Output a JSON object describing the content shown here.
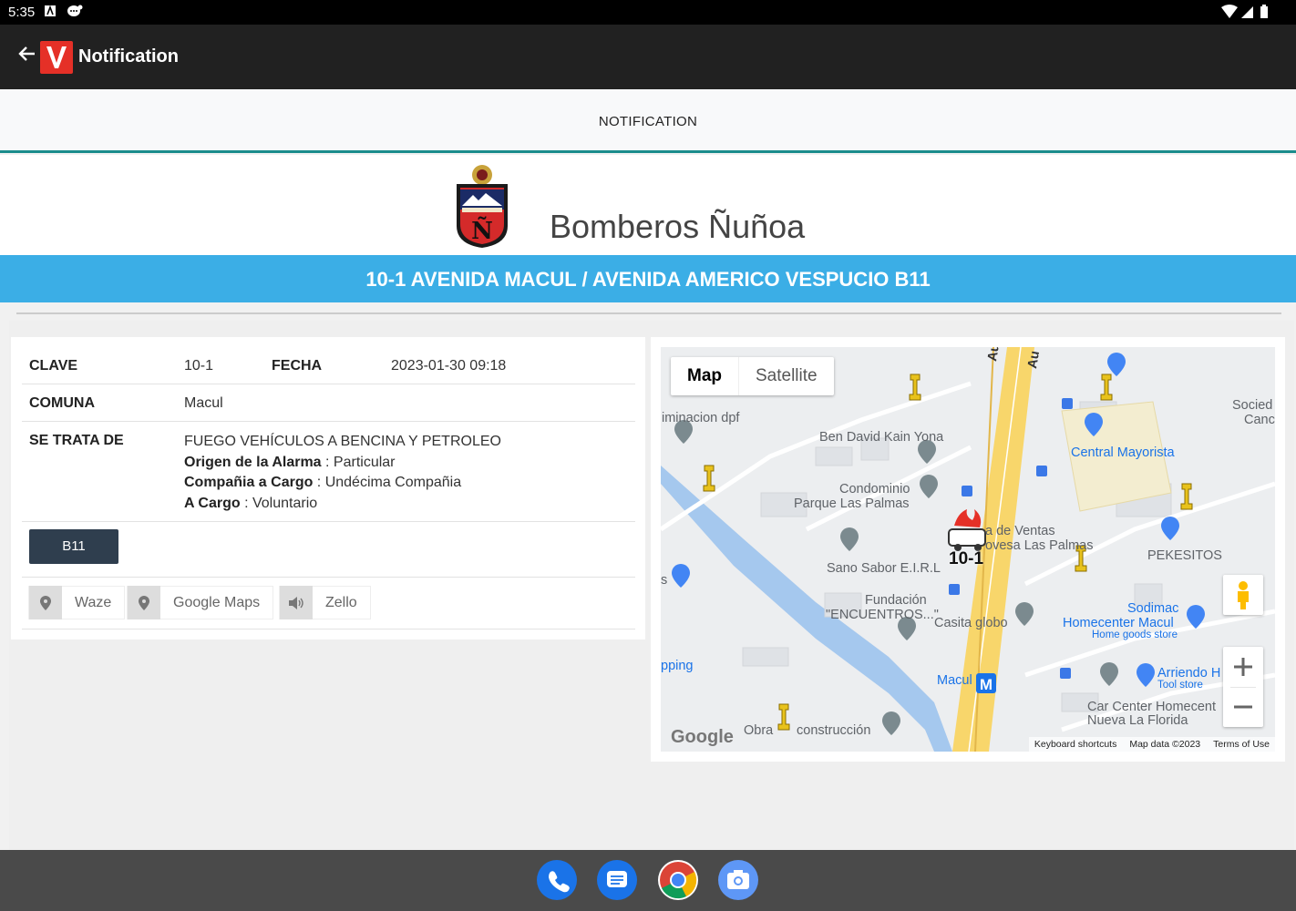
{
  "status": {
    "time": "5:35"
  },
  "appbar": {
    "title": "Notification"
  },
  "tab": {
    "label": "NOTIFICATION"
  },
  "org": {
    "name": "Bomberos Ñuñoa"
  },
  "banner": {
    "text": "10-1 AVENIDA MACUL / AVENIDA AMERICO VESPUCIO B11"
  },
  "details": {
    "clave_label": "CLAVE",
    "clave_value": "10-1",
    "fecha_label": "FECHA",
    "fecha_value": "2023-01-30 09:18",
    "comuna_label": "COMUNA",
    "comuna_value": "Macul",
    "setrata_label": "SE TRATA DE",
    "setrata_value": "FUEGO VEHÍCULOS A BENCINA Y PETROLEO",
    "origen_label": "Origen de la Alarma",
    "origen_value": " : Particular",
    "compania_label": "Compañia a Cargo",
    "compania_value": " : Undécima Compañia",
    "acargo_label": "A Cargo",
    "acargo_value": " : Voluntario"
  },
  "unit_button": "B11",
  "nav_buttons": {
    "waze": "Waze",
    "google_maps": "Google Maps",
    "zello": "Zello"
  },
  "map": {
    "tab_map": "Map",
    "tab_satellite": "Satellite",
    "marker_label": "10-1",
    "footer": {
      "shortcuts": "Keyboard shortcuts",
      "data": "Map data ©2023",
      "terms": "Terms of Use"
    },
    "google": "Google",
    "places": {
      "p1": "iminacion dpf",
      "p2": "Ben David Kain Yona",
      "p3": "Condominio",
      "p4": "Parque Las Palmas",
      "p5": "Central Mayorista",
      "p6": "Sano Sabor E.I.R.L",
      "p7": "Fundación",
      "p8": "\"ENCUENTROS...\"",
      "p9": "Casita globo",
      "p10": "PEKESITOS",
      "p11": "Sodimac",
      "p12": "Homecenter Macul",
      "p13": "Home goods store",
      "p14": "pping",
      "p15": "Macul",
      "p16": "Arriendo H",
      "p17": "Tool store",
      "p18": "Car Center Homecent",
      "p19": "Nueva La Florida",
      "p20": "Obra",
      "p21": "construcción",
      "p22": "a de Ventas",
      "p23": "ovesa Las Palmas",
      "p24": "Socied",
      "p25": "Canc",
      "p26": "Autop. A",
      "p27": "Au",
      "p28": "s"
    }
  },
  "colors": {
    "banner": "#3baee6",
    "appbar": "#212121",
    "accent": "#1a8c8c",
    "unit_button": "#2f3e4e"
  }
}
